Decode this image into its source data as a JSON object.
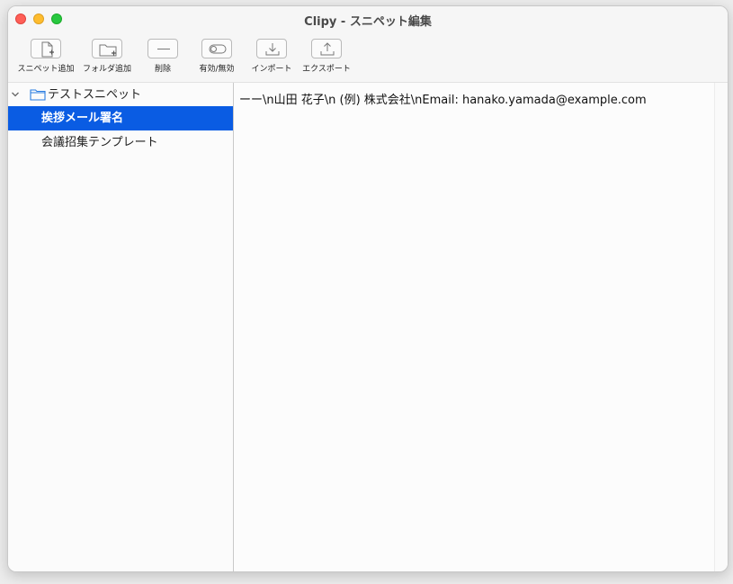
{
  "window": {
    "title": "Clipy - スニペット編集"
  },
  "toolbar": {
    "items": [
      {
        "label": "スニペット追加",
        "icon": "add-snippet-icon"
      },
      {
        "label": "フォルダ追加",
        "icon": "add-folder-icon"
      },
      {
        "label": "削除",
        "icon": "delete-icon"
      },
      {
        "label": "有効/無効",
        "icon": "toggle-icon"
      },
      {
        "label": "インポート",
        "icon": "import-icon"
      },
      {
        "label": "エクスポート",
        "icon": "export-icon"
      }
    ]
  },
  "sidebar": {
    "folder": {
      "label": "テストスニペット",
      "expanded": true
    },
    "items": [
      {
        "label": "挨拶メール署名",
        "selected": true
      },
      {
        "label": "会議招集テンプレート",
        "selected": false
      }
    ]
  },
  "editor": {
    "content": "ーー\\n山田 花子\\n (例) 株式会社\\nEmail: hanako.yamada@example.com"
  },
  "colors": {
    "selection": "#0a5ce3",
    "close": "#ff5f57",
    "minimize": "#febc2e",
    "maximize": "#28c840",
    "folder_icon": "#2a7de1"
  }
}
